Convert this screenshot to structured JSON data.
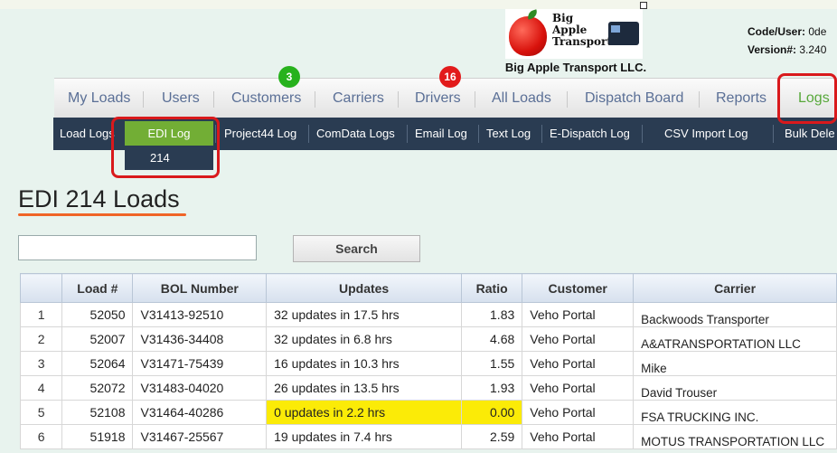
{
  "header": {
    "logo_text": [
      "Big",
      "Apple",
      "Transport"
    ],
    "company_name": "Big Apple Transport LLC.",
    "code_user_label": "Code/User:",
    "code_user_value": "0de",
    "version_label": "Version#:",
    "version_value": "3.240"
  },
  "main_nav": {
    "items": [
      {
        "label": "My Loads"
      },
      {
        "label": "Users"
      },
      {
        "label": "Customers",
        "badge": "3"
      },
      {
        "label": "Carriers"
      },
      {
        "label": "Drivers",
        "badge": "16"
      },
      {
        "label": "All Loads"
      },
      {
        "label": "Dispatch Board"
      },
      {
        "label": "Reports"
      },
      {
        "label": "Logs"
      }
    ]
  },
  "sub_nav": {
    "items": [
      {
        "label": "Load Logs"
      },
      {
        "label": "EDI Log"
      },
      {
        "label": "Project44 Log"
      },
      {
        "label": "ComData Logs"
      },
      {
        "label": "Email Log"
      },
      {
        "label": "Text Log"
      },
      {
        "label": "E-Dispatch Log"
      },
      {
        "label": "CSV Import Log"
      },
      {
        "label": "Bulk Dele"
      }
    ],
    "dropdown": {
      "label": "214"
    }
  },
  "page": {
    "title": "EDI 214 Loads"
  },
  "search": {
    "value": "",
    "placeholder": "",
    "button_label": "Search"
  },
  "table": {
    "columns": [
      "",
      "Load #",
      "BOL Number",
      "Updates",
      "Ratio",
      "Customer",
      "Carrier"
    ],
    "rows": [
      {
        "n": "1",
        "load": "52050",
        "bol": "V31413-92510",
        "updates": "32 updates in 17.5 hrs",
        "ratio": "1.83",
        "customer": "Veho Portal",
        "carrier": "Backwoods Transporter",
        "highlight": false
      },
      {
        "n": "2",
        "load": "52007",
        "bol": "V31436-34408",
        "updates": "32 updates in 6.8 hrs",
        "ratio": "4.68",
        "customer": "Veho Portal",
        "carrier": "A&ATRANSPORTATION LLC",
        "highlight": false
      },
      {
        "n": "3",
        "load": "52064",
        "bol": "V31471-75439",
        "updates": "16 updates in 10.3 hrs",
        "ratio": "1.55",
        "customer": "Veho Portal",
        "carrier": "Mike",
        "highlight": false
      },
      {
        "n": "4",
        "load": "52072",
        "bol": "V31483-04020",
        "updates": "26 updates in 13.5 hrs",
        "ratio": "1.93",
        "customer": "Veho Portal",
        "carrier": "David Trouser",
        "highlight": false
      },
      {
        "n": "5",
        "load": "52108",
        "bol": "V31464-40286",
        "updates": "0 updates in 2.2 hrs",
        "ratio": "0.00",
        "customer": "Veho Portal",
        "carrier": "FSA TRUCKING INC.",
        "highlight": true
      },
      {
        "n": "6",
        "load": "51918",
        "bol": "V31467-25567",
        "updates": "19 updates in 7.4 hrs",
        "ratio": "2.59",
        "customer": "Veho Portal",
        "carrier": "MOTUS TRANSPORTATION LLC",
        "highlight": false
      }
    ]
  },
  "colors": {
    "nav_text": "#5a6f96",
    "active_green": "#72ae35",
    "subnav_bg": "#2a3c52",
    "annotation_red": "#d9191c",
    "highlight_yellow": "#fbeb07",
    "title_underline": "#f06427"
  }
}
